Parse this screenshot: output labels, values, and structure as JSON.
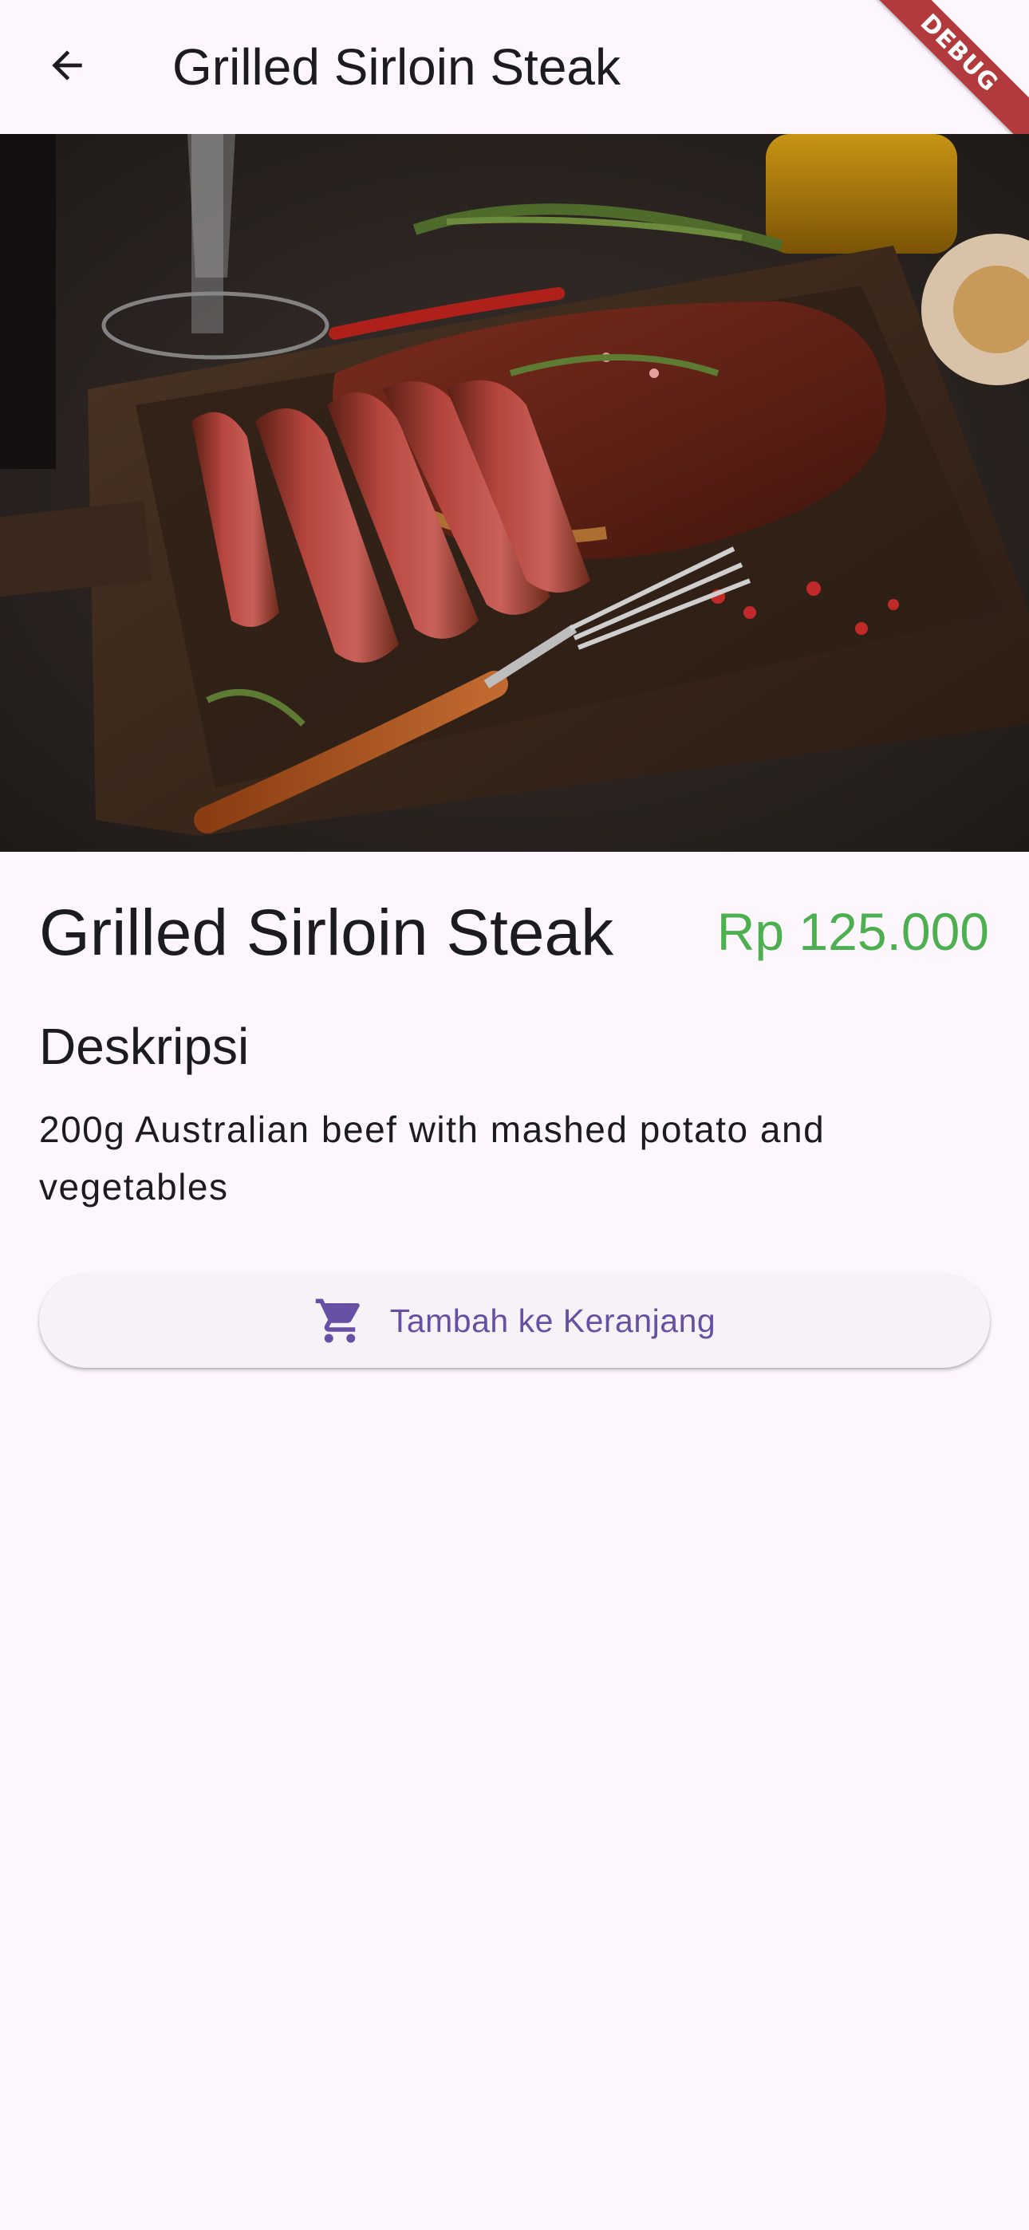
{
  "app_bar": {
    "title": "Grilled Sirloin Steak",
    "back_icon": "arrow-left-icon"
  },
  "debug_banner": "DEBUG",
  "product": {
    "name": "Grilled Sirloin Steak",
    "price": "Rp 125.000",
    "description_heading": "Deskripsi",
    "description": "200g Australian beef with mashed potato and vegetables"
  },
  "actions": {
    "add_to_cart_label": "Tambah ke Keranjang",
    "add_to_cart_icon": "shopping-cart-icon"
  },
  "colors": {
    "background": "#fdf7fd",
    "price": "#4caf50",
    "accent": "#6750a4",
    "debug_ribbon": "#b23a3d"
  }
}
